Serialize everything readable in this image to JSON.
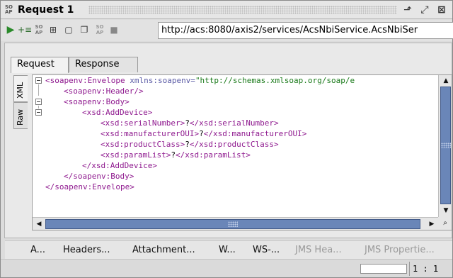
{
  "window": {
    "title": "Request 1",
    "icon_text": "SO AP",
    "buttons": [
      "detach-icon",
      "float-icon",
      "close-icon"
    ]
  },
  "toolbar": {
    "icons": [
      "run-icon",
      "add-assertion-icon",
      "soap-icon",
      "create-test-icon",
      "maximize-icon",
      "stop-soap-icon",
      "stop-icon"
    ],
    "endpoint_url": "http://acs:8080/axis2/services/AcsNbiService.AcsNbiSer"
  },
  "top_tabs": [
    {
      "label": "Request",
      "active": true
    },
    {
      "label": "Response",
      "active": false
    }
  ],
  "side_tabs": [
    {
      "label": "XML",
      "active": true
    },
    {
      "label": "Raw",
      "active": false
    }
  ],
  "editor": {
    "lines": [
      {
        "indent": 0,
        "open": "<soapenv:Envelope",
        "attr": " xmlns:soapenv=",
        "val": "\"http://schemas.xmlsoap.org/soap/e",
        "close": ""
      },
      {
        "indent": 4,
        "open": "<soapenv:Header/>",
        "attr": "",
        "val": "",
        "close": ""
      },
      {
        "indent": 4,
        "open": "<soapenv:Body>",
        "attr": "",
        "val": "",
        "close": ""
      },
      {
        "indent": 8,
        "open": "<xsd:AddDevice>",
        "attr": "",
        "val": "",
        "close": ""
      },
      {
        "indent": 12,
        "open": "<xsd:serialNumber>",
        "text": "?",
        "close": "</xsd:serialNumber>"
      },
      {
        "indent": 12,
        "open": "<xsd:manufacturerOUI>",
        "text": "?",
        "close": "</xsd:manufacturerOUI>"
      },
      {
        "indent": 12,
        "open": "<xsd:productClass>",
        "text": "?",
        "close": "</xsd:productClass>"
      },
      {
        "indent": 12,
        "open": "<xsd:paramList>",
        "text": "?",
        "close": "</xsd:paramList>"
      },
      {
        "indent": 8,
        "open": "</xsd:AddDevice>",
        "attr": "",
        "val": "",
        "close": ""
      },
      {
        "indent": 4,
        "open": "</soapenv:Body>",
        "attr": "",
        "val": "",
        "close": ""
      },
      {
        "indent": 0,
        "open": "</soapenv:Envelope>",
        "attr": "",
        "val": "",
        "close": ""
      }
    ]
  },
  "bottom_tabs": [
    {
      "label": "A...",
      "enabled": true
    },
    {
      "label": "Headers...",
      "enabled": true
    },
    {
      "label": "Attachment...",
      "enabled": true
    },
    {
      "label": "W...",
      "enabled": true
    },
    {
      "label": "WS-...",
      "enabled": true
    },
    {
      "label": "JMS Hea...",
      "enabled": false
    },
    {
      "label": "JMS Propertie...",
      "enabled": false
    }
  ],
  "status": {
    "cursor_position": "1 : 1"
  },
  "colors": {
    "tag": "#8f1a8f",
    "attr": "#5a5aa5",
    "value": "#1a7a1a",
    "scroll_thumb": "#6a86b8"
  }
}
